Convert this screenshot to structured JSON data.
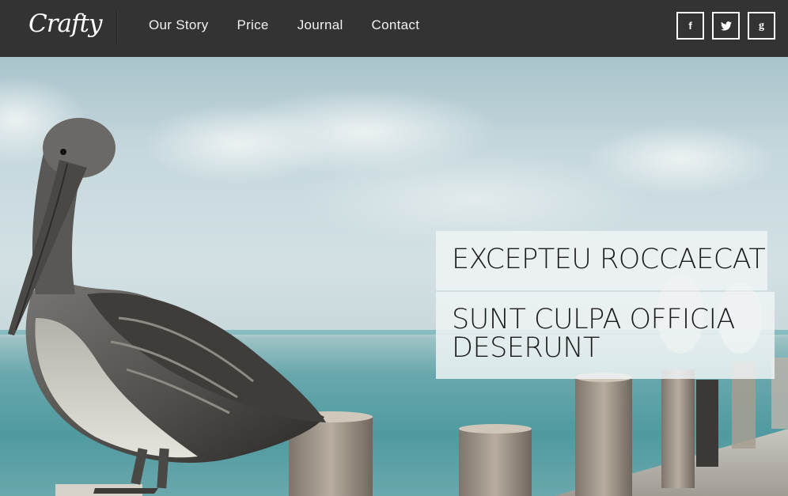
{
  "brand": {
    "logo_text": "Crafty"
  },
  "nav": {
    "items": [
      {
        "label": "Our Story"
      },
      {
        "label": "Price"
      },
      {
        "label": "Journal"
      },
      {
        "label": "Contact"
      }
    ]
  },
  "social": {
    "facebook": {
      "glyph": "f",
      "icon": "facebook-icon"
    },
    "twitter": {
      "icon": "twitter-icon"
    },
    "google": {
      "glyph": "g",
      "icon": "google-plus-icon"
    }
  },
  "hero": {
    "caption_1": "EXCEPTEU ROCCAECAT",
    "caption_2_line_1": "SUNT CULPA OFFICIA",
    "caption_2_line_2": "DESERUNT"
  },
  "colors": {
    "navbar_bg": "#333333",
    "nav_text": "#f2f2f2",
    "caption_bg": "rgba(240,244,246,0.84)",
    "caption_text": "#1c1c1c"
  }
}
